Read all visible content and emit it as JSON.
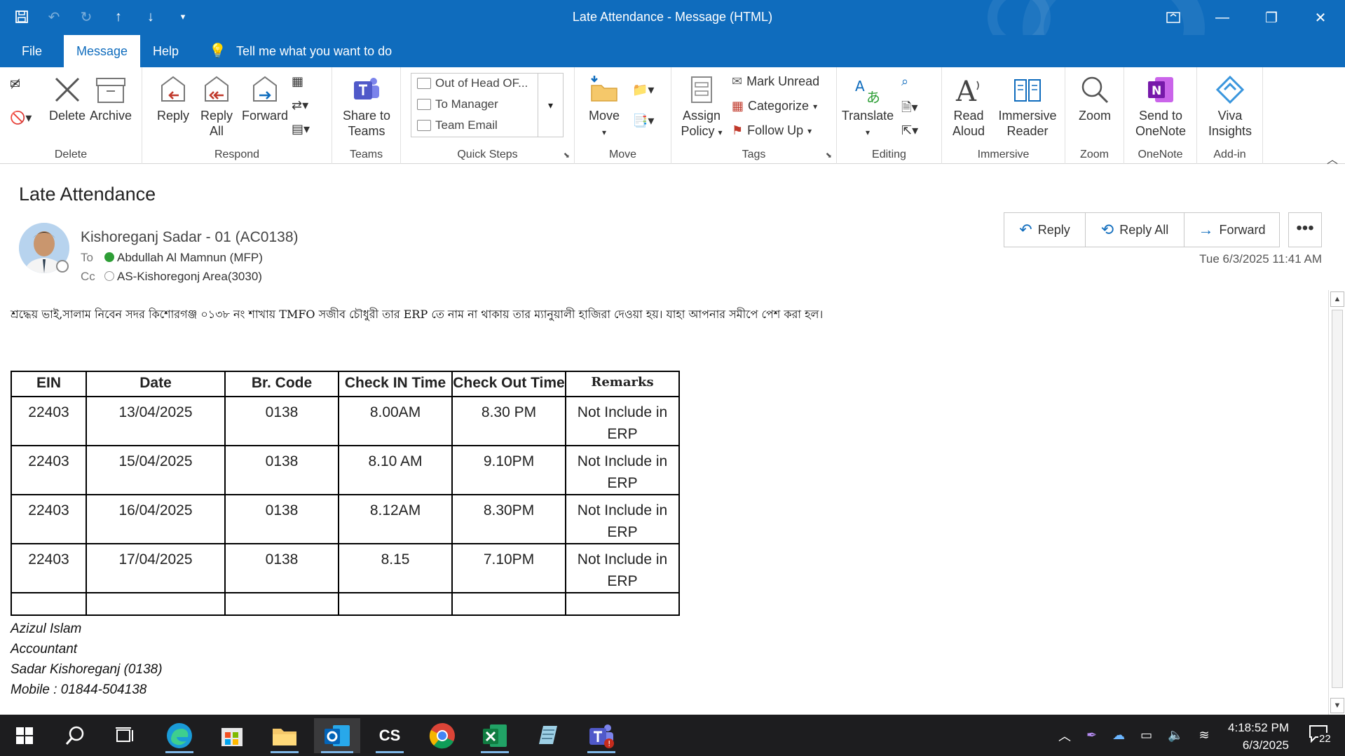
{
  "window": {
    "title": "Late Attendance  -  Message (HTML)"
  },
  "menu": {
    "file": "File",
    "message": "Message",
    "help": "Help",
    "tell_me": "Tell me what you want to do"
  },
  "ribbon": {
    "delete_group": {
      "label": "Delete",
      "delete": "Delete",
      "archive": "Archive"
    },
    "respond_group": {
      "label": "Respond",
      "reply": "Reply",
      "reply_all_1": "Reply",
      "reply_all_2": "All",
      "forward": "Forward"
    },
    "teams_group": {
      "label": "Teams",
      "share_1": "Share to",
      "share_2": "Teams"
    },
    "quick_steps": {
      "label": "Quick Steps",
      "items": [
        "Out of Head OF...",
        "To Manager",
        "Team Email"
      ]
    },
    "move_group": {
      "label": "Move",
      "move": "Move"
    },
    "tags_group": {
      "label": "Tags",
      "assign_1": "Assign",
      "assign_2": "Policy",
      "mark_unread": "Mark Unread",
      "categorize": "Categorize",
      "follow_up": "Follow Up"
    },
    "editing_group": {
      "label": "Editing",
      "translate": "Translate"
    },
    "immersive_group": {
      "label": "Immersive",
      "read_1": "Read",
      "read_2": "Aloud",
      "reader_1": "Immersive",
      "reader_2": "Reader"
    },
    "zoom_group": {
      "label": "Zoom",
      "zoom": "Zoom"
    },
    "onenote_group": {
      "label": "OneNote",
      "send_1": "Send to",
      "send_2": "OneNote"
    },
    "addin_group": {
      "label": "Add-in",
      "viva_1": "Viva",
      "viva_2": "Insights"
    }
  },
  "message": {
    "subject": "Late Attendance",
    "sender": "Kishoreganj Sadar -  01 (AC0138)",
    "to_label": "To",
    "to": "Abdullah Al Mamnun (MFP)",
    "cc_label": "Cc",
    "cc": "AS-Kishoregonj Area(3030)",
    "date": "Tue 6/3/2025 11:41 AM",
    "reply": "Reply",
    "reply_all": "Reply All",
    "forward": "Forward",
    "more": "•••",
    "body": "শ্রদ্ধেয় ভাই,সালাম নিবেন সদর কিশোরগঞ্জ ০১৩৮ নং শাখায় TMFO সজীব চৌধুরী তার ERP তে নাম না থাকায় তার ম্যানুয়ালী হাজিরা দেওয়া হয়। যাহা আপনার সমীপে পেশ করা হল।",
    "table": {
      "headers": [
        "EIN",
        "Date",
        "Br. Code",
        "Check IN Time",
        "Check Out Time",
        "Remarks"
      ],
      "rows": [
        [
          "22403",
          "13/04/2025",
          "0138",
          "8.00AM",
          "8.30 PM",
          "Not Include in ERP"
        ],
        [
          "22403",
          "15/04/2025",
          "0138",
          "8.10 AM",
          "9.10PM",
          "Not Include in ERP"
        ],
        [
          "22403",
          "16/04/2025",
          "0138",
          "8.12AM",
          "8.30PM",
          "Not Include in ERP"
        ],
        [
          "22403",
          "17/04/2025",
          "0138",
          "8.15",
          "7.10PM",
          "Not Include in ERP"
        ]
      ]
    },
    "signature": [
      "Azizul Islam",
      "Accountant",
      "Sadar Kishoreganj (0138)",
      "Mobile : 01844-504138"
    ]
  },
  "taskbar": {
    "cs_label": "CS",
    "time": "4:18:52 PM",
    "date": "6/3/2025",
    "notification_count": "22"
  }
}
